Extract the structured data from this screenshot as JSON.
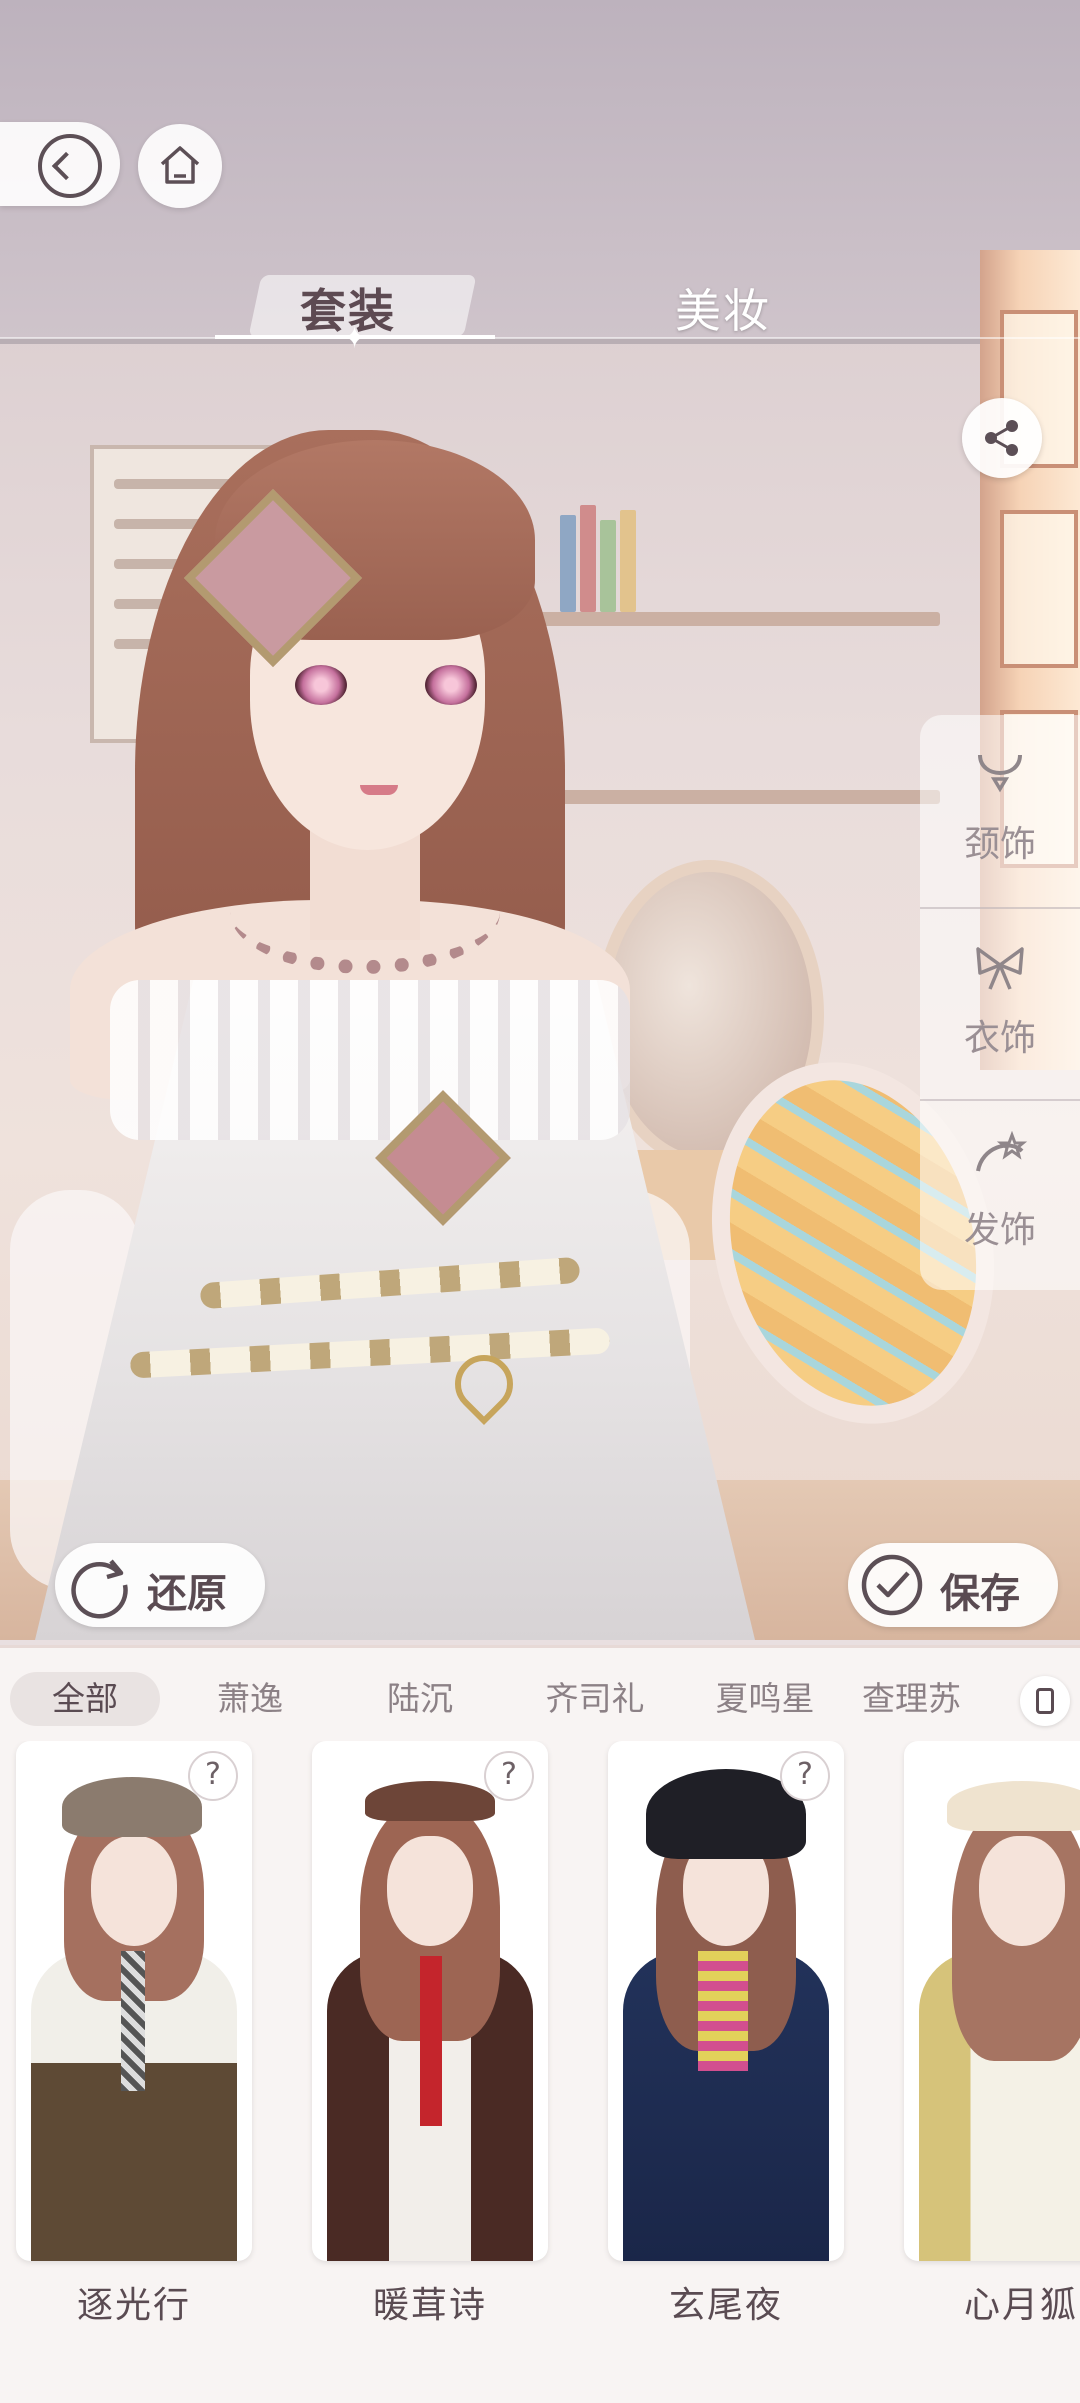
{
  "top_nav": {
    "back_icon": "back-arrow-icon",
    "home_icon": "home-icon"
  },
  "tabs": [
    {
      "label": "套装",
      "active": true
    },
    {
      "label": "美妆",
      "active": false
    }
  ],
  "share_icon": "share-icon",
  "accessories": [
    {
      "label": "颈饰",
      "icon": "necklace-icon"
    },
    {
      "label": "衣饰",
      "icon": "bow-icon"
    },
    {
      "label": "发饰",
      "icon": "hairpin-icon"
    }
  ],
  "actions": {
    "restore_label": "还原",
    "save_label": "保存"
  },
  "filters": [
    {
      "label": "全部",
      "active": true
    },
    {
      "label": "萧逸",
      "active": false
    },
    {
      "label": "陆沉",
      "active": false
    },
    {
      "label": "齐司礼",
      "active": false
    },
    {
      "label": "夏鸣星",
      "active": false
    },
    {
      "label": "查理苏",
      "active": false
    }
  ],
  "outfits": [
    {
      "name": "逐光行",
      "badge": "?"
    },
    {
      "name": "暖茸诗",
      "badge": "?"
    },
    {
      "name": "玄尾夜",
      "badge": "?"
    },
    {
      "name": "心月狐",
      "badge": ""
    }
  ],
  "colors": {
    "accent_text": "#5a4b52",
    "muted_text": "#8c8186",
    "panel_bg": "#f8f4f3"
  }
}
